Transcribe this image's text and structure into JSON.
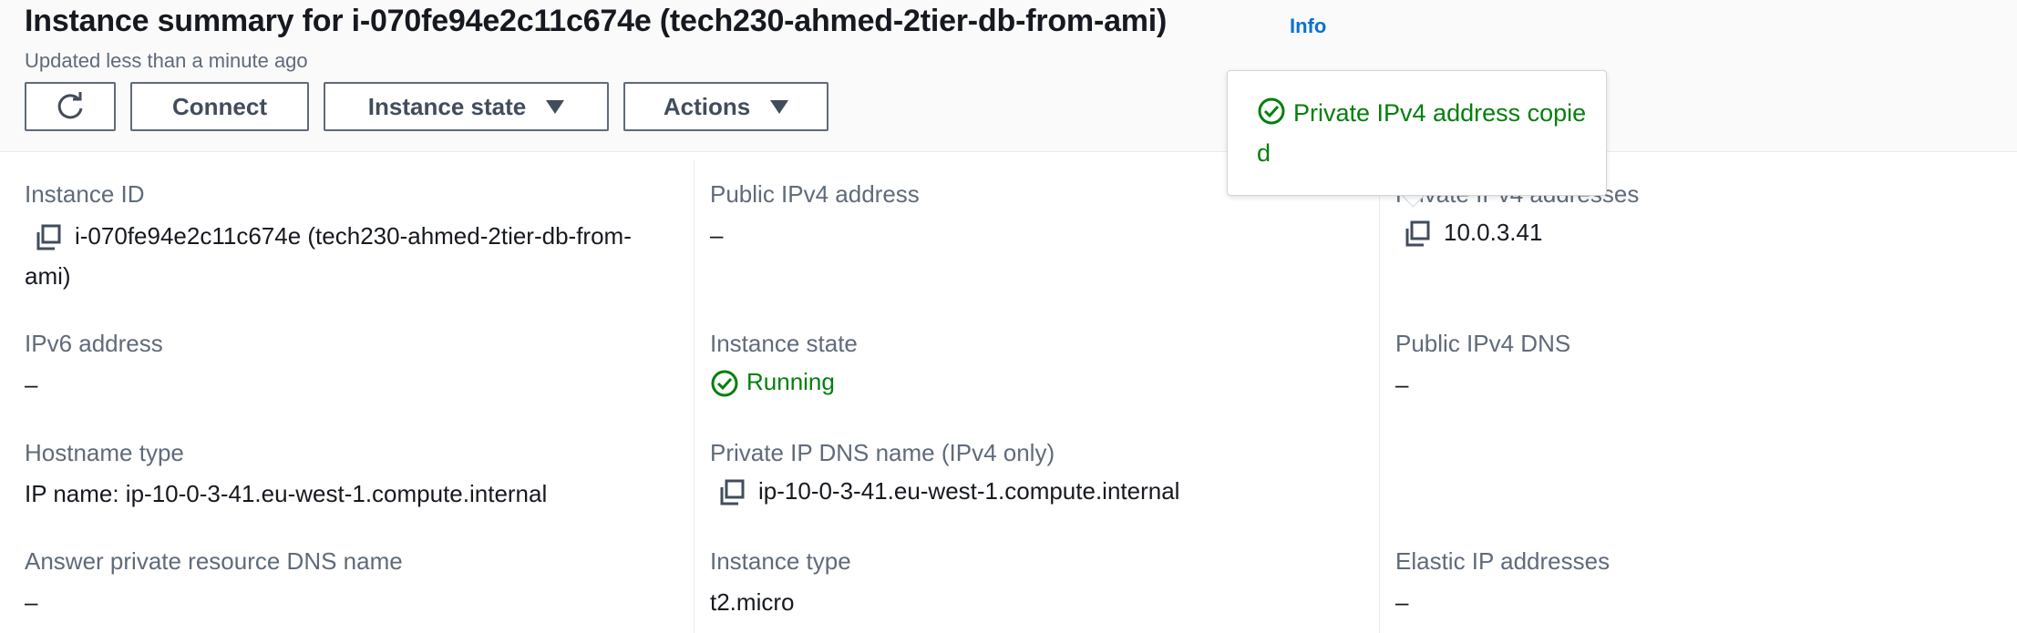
{
  "header": {
    "title": "Instance summary for i-070fe94e2c11c674e (tech230-ahmed-2tier-db-from-ami)",
    "info_link": "Info",
    "updated": "Updated less than a minute ago"
  },
  "toolbar": {
    "connect_label": "Connect",
    "instance_state_label": "Instance state",
    "actions_label": "Actions"
  },
  "tooltip": {
    "message": "Private IPv4 address copied"
  },
  "details": {
    "instance_id": {
      "label": "Instance ID",
      "value": "i-070fe94e2c11c674e (tech230-ahmed-2tier-db-from-ami)"
    },
    "public_ipv4": {
      "label": "Public IPv4 address",
      "value": "–"
    },
    "private_ipv4": {
      "label": "Private IPv4 addresses",
      "value": "10.0.3.41"
    },
    "ipv6": {
      "label": "IPv6 address",
      "value": "–"
    },
    "instance_state": {
      "label": "Instance state",
      "value": "Running"
    },
    "public_dns": {
      "label": "Public IPv4 DNS",
      "value": "–"
    },
    "hostname_type": {
      "label": "Hostname type",
      "value": "IP name: ip-10-0-3-41.eu-west-1.compute.internal"
    },
    "private_dns": {
      "label": "Private IP DNS name (IPv4 only)",
      "value": "ip-10-0-3-41.eu-west-1.compute.internal"
    },
    "answer_dns": {
      "label": "Answer private resource DNS name",
      "value": "–"
    },
    "instance_type": {
      "label": "Instance type",
      "value": "t2.micro"
    },
    "elastic_ip": {
      "label": "Elastic IP addresses",
      "value": "–"
    }
  },
  "colors": {
    "accent_link": "#0972d3",
    "success": "#037f0c",
    "label_gray": "#5f6b7a",
    "text": "#16191f"
  },
  "icons": [
    "refresh-icon",
    "caret-down-icon",
    "copy-icon",
    "status-success-icon"
  ]
}
